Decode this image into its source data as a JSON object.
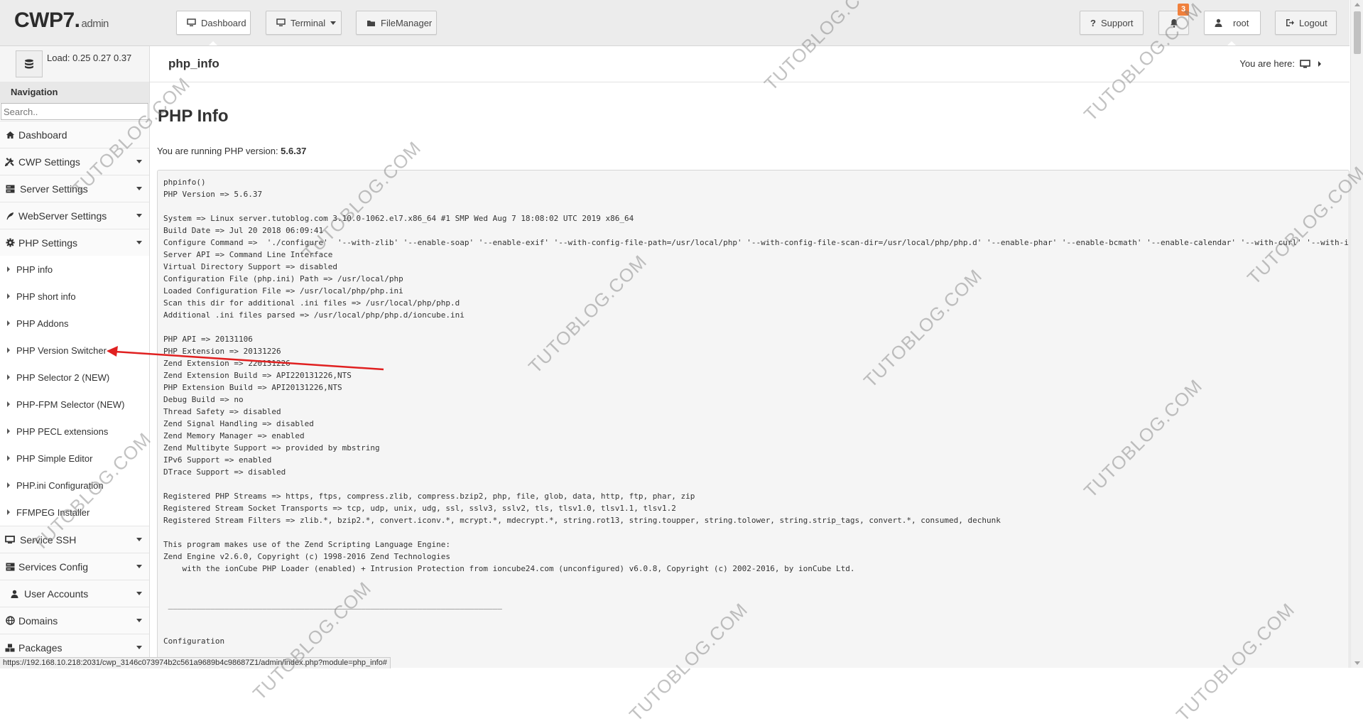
{
  "header": {
    "logo_main": "CWP7.",
    "logo_sub": "admin",
    "dashboard_label": "Dashboard",
    "terminal_label": "Terminal",
    "filemanager_label": "FileManager",
    "support_label": "Support",
    "notification_count": "3",
    "user_label": "root",
    "logout_label": "Logout"
  },
  "load": {
    "text": "Load: 0.25  0.27  0.37"
  },
  "page": {
    "title": "php_info",
    "you_are_here": "You are here:"
  },
  "sidebar": {
    "heading": "Navigation",
    "search_placeholder": "Search..",
    "items": [
      {
        "label": "Dashboard",
        "icon": "home-icon"
      },
      {
        "label": "CWP Settings",
        "icon": "tools-icon"
      },
      {
        "label": "Server Settings",
        "icon": "server-icon"
      },
      {
        "label": "WebServer Settings",
        "icon": "feather-icon"
      },
      {
        "label": "PHP Settings",
        "icon": "gear-icon"
      }
    ],
    "php_submenu": [
      "PHP info",
      "PHP short info",
      "PHP Addons",
      "PHP Version Switcher",
      "PHP Selector 2 (NEW)",
      "PHP-FPM Selector (NEW)",
      "PHP PECL extensions",
      "PHP Simple Editor",
      "PHP.ini Configuration",
      "FFMPEG Installer"
    ],
    "bottom_items": [
      {
        "label": "Service SSH",
        "icon": "monitor-icon"
      },
      {
        "label": "Services Config",
        "icon": "server-icon"
      },
      {
        "label": "User Accounts",
        "icon": "user-icon"
      },
      {
        "label": "Domains",
        "icon": "globe-icon"
      },
      {
        "label": "Packages",
        "icon": "cubes-icon"
      }
    ]
  },
  "main": {
    "heading": "PHP Info",
    "version_prefix": "You are running PHP version: ",
    "version": "5.6.37",
    "phpinfo_lines": [
      "phpinfo()",
      "PHP Version => 5.6.37",
      "",
      "System => Linux server.tutoblog.com 3.10.0-1062.el7.x86_64 #1 SMP Wed Aug 7 18:08:02 UTC 2019 x86_64",
      "Build Date => Jul 20 2018 06:09:41",
      "Configure Command =>  './configure'  '--with-zlib' '--enable-soap' '--enable-exif' '--with-config-file-path=/usr/local/php' '--with-config-file-scan-dir=/usr/local/php/php.d' '--enable-phar' '--enable-bcmath' '--enable-calendar' '--with-curl' '--with-i",
      "Server API => Command Line Interface",
      "Virtual Directory Support => disabled",
      "Configuration File (php.ini) Path => /usr/local/php",
      "Loaded Configuration File => /usr/local/php/php.ini",
      "Scan this dir for additional .ini files => /usr/local/php/php.d",
      "Additional .ini files parsed => /usr/local/php/php.d/ioncube.ini",
      "",
      "PHP API => 20131106",
      "PHP Extension => 20131226",
      "Zend Extension => 220131226",
      "Zend Extension Build => API220131226,NTS",
      "PHP Extension Build => API20131226,NTS",
      "Debug Build => no",
      "Thread Safety => disabled",
      "Zend Signal Handling => disabled",
      "Zend Memory Manager => enabled",
      "Zend Multibyte Support => provided by mbstring",
      "IPv6 Support => enabled",
      "DTrace Support => disabled",
      "",
      "Registered PHP Streams => https, ftps, compress.zlib, compress.bzip2, php, file, glob, data, http, ftp, phar, zip",
      "Registered Stream Socket Transports => tcp, udp, unix, udg, ssl, sslv3, sslv2, tls, tlsv1.0, tlsv1.1, tlsv1.2",
      "Registered Stream Filters => zlib.*, bzip2.*, convert.iconv.*, mcrypt.*, mdecrypt.*, string.rot13, string.toupper, string.tolower, string.strip_tags, convert.*, consumed, dechunk",
      "",
      "This program makes use of the Zend Scripting Language Engine:",
      "Zend Engine v2.6.0, Copyright (c) 1998-2016 Zend Technologies",
      "    with the ionCube PHP Loader (enabled) + Intrusion Protection from ioncube24.com (unconfigured) v6.0.8, Copyright (c) 2002-2016, by ionCube Ltd.",
      "",
      "",
      " _______________________________________________________________________",
      "",
      "",
      "Configuration"
    ]
  },
  "status_url": "https://192.168.10.218:2031/cwp_3146c073974b2c561a9689b4c98687Z1/admin/index.php?module=php_info#",
  "watermark": "TUTOBLOG.COM",
  "colors": {
    "badge": "#f0803c",
    "annotation_arrow": "#e02020"
  }
}
